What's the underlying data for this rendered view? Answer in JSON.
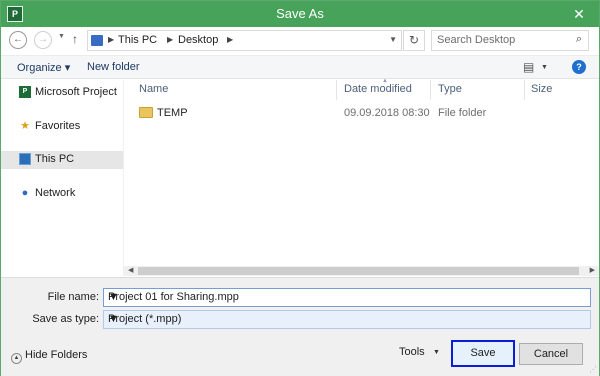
{
  "window": {
    "title": "Save As",
    "app_icon_text": "P",
    "close_glyph": "✕"
  },
  "address": {
    "crumbs": [
      "This PC",
      "Desktop"
    ],
    "search_placeholder": "Search Desktop"
  },
  "toolbar": {
    "organize_label": "Organize ▾",
    "new_folder_label": "New folder"
  },
  "nav": {
    "items": [
      {
        "label": "Microsoft Project",
        "icon": "project-icon"
      },
      {
        "label": "Favorites",
        "icon": "star-icon"
      },
      {
        "label": "This PC",
        "icon": "computer-icon",
        "selected": true
      },
      {
        "label": "Network",
        "icon": "network-icon"
      }
    ]
  },
  "columns": {
    "name": "Name",
    "date": "Date modified",
    "type": "Type",
    "size": "Size"
  },
  "files": [
    {
      "name": "TEMP",
      "date": "09.09.2018 08:30",
      "type": "File folder",
      "size": ""
    }
  ],
  "form": {
    "file_name_label": "File name:",
    "file_name_value": "Project 01 for Sharing.mpp",
    "save_type_label": "Save as type:",
    "save_type_value": "Project (*.mpp)"
  },
  "footer": {
    "hide_folders_label": "Hide Folders",
    "tools_label": "Tools",
    "save_label": "Save",
    "cancel_label": "Cancel"
  },
  "colors": {
    "titlebar": "#47a35a",
    "save_highlight": "#0a1ed8"
  }
}
